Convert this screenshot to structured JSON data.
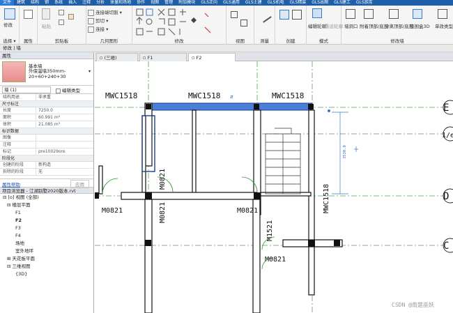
{
  "menu": [
    "文件",
    "建筑",
    "结构",
    "钢",
    "系统",
    "插入",
    "注释",
    "分析",
    "体量和场地",
    "协作",
    "视图",
    "管理",
    "附加模块",
    "GLS正向",
    "GLS通用",
    "GLS土建",
    "GLS机电",
    "GLS精装",
    "GLS出图",
    "GLS建工",
    "GLS族库"
  ],
  "ribbon": {
    "modify_label": "修改",
    "select_label": "选择 ▾",
    "properties_label": "属性",
    "clipboard_label": "剪贴板",
    "paste_label": "粘贴",
    "geometry_label": "几何图形",
    "cut_join": "连接端切割 ▾",
    "cut": "剪切 ▾",
    "join": "连接 ▾",
    "modify_group_label": "修改",
    "view_label": "视图",
    "measure_label": "测量",
    "create_label": "创建",
    "mode_label": "模式",
    "edit_profile": "编辑轮廓",
    "reset_profile": "重设轮廓",
    "wall_opening": "墙洞口",
    "attach": "附着顶部/底部",
    "detach": "分离顶部/底部",
    "envelope": "包围盒3D",
    "single_family": "单改类型名 ▾",
    "modify_wall_label": "修改墙"
  },
  "modebar": "修改 | 墙",
  "properties": {
    "title": "属性",
    "type_name": "基本墙",
    "type_sub": "外保温墙350mm- 20+60+240+30",
    "selector": "墙 (1)",
    "edit_type": "编辑类型",
    "rows_top": [
      {
        "k": "结构用途",
        "v": "非承重"
      }
    ],
    "sec_dim": "尺寸标注",
    "dims": [
      {
        "k": "长度",
        "v": "7250.0"
      },
      {
        "k": "面积",
        "v": "60.991 m²"
      },
      {
        "k": "体积",
        "v": "21.085 m³"
      }
    ],
    "sec_id": "标识数据",
    "ids": [
      {
        "k": "图像",
        "v": ""
      },
      {
        "k": "注释",
        "v": ""
      },
      {
        "k": "标记",
        "v": "pre10029ore"
      }
    ],
    "sec_phase": "阶段化",
    "phases": [
      {
        "k": "创建的阶段",
        "v": "新构造"
      },
      {
        "k": "拆除的阶段",
        "v": "无"
      }
    ],
    "help": "属性帮助",
    "apply": "应用"
  },
  "browser": {
    "title": "项目浏览器 - 江湖别墅2020版本.rvt",
    "items": [
      "⊟ [o] 视图 (全部)",
      "⊟ 楼层平面",
      "F1",
      "F2",
      "F3",
      "F4",
      "场地",
      "室外地坪",
      "⊞ 天花板平面",
      "⊟ 三维视图",
      "{3D}"
    ]
  },
  "tabs": [
    "(三维)",
    "F1",
    "F2"
  ],
  "drawing": {
    "labels": [
      "MWC1518",
      "MWC1518",
      "MWC1518",
      "M0821",
      "M0821",
      "M0821",
      "M0821",
      "M1521",
      "M0821",
      "MWC1518"
    ],
    "dim": "3520.0",
    "grids": [
      "E",
      "1/eho",
      "D",
      "C"
    ],
    "watermark": "CSDN @南楚巫妖"
  }
}
